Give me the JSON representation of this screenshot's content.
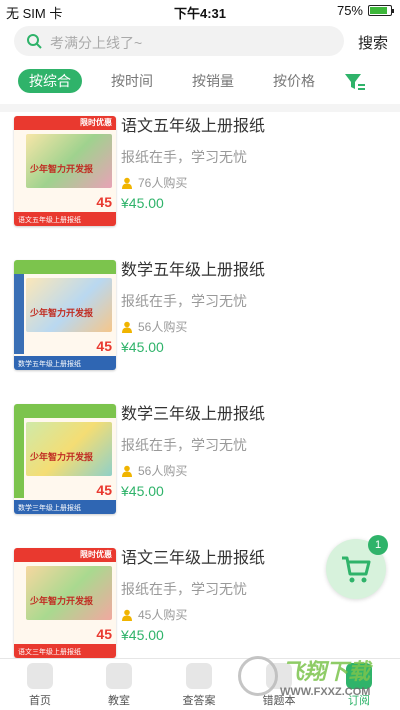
{
  "status_bar": {
    "carrier": "无 SIM 卡",
    "time": "下午4:31",
    "battery": "75%",
    "battery_level": 0.75
  },
  "search": {
    "placeholder": "考满分上线了~",
    "button": "搜索"
  },
  "tabs": [
    {
      "label": "按综合",
      "active": true
    },
    {
      "label": "按时间",
      "active": false
    },
    {
      "label": "按销量",
      "active": false
    },
    {
      "label": "按价格",
      "active": false
    }
  ],
  "items": [
    {
      "title": "语文五年级上册报纸",
      "subtitle": "报纸在手，学习无忧",
      "buyers": "76人购买",
      "price": "¥45.00",
      "cover": {
        "top_label": "少年智力开发报",
        "badge": "限时优惠",
        "bottom_label": "语文五年级上册报纸",
        "price": "45"
      }
    },
    {
      "title": "数学五年级上册报纸",
      "subtitle": "报纸在手，学习无忧",
      "buyers": "56人购买",
      "price": "¥45.00",
      "cover": {
        "top_label": "少年智力开发报",
        "badge": "",
        "bottom_label": "数学五年级上册报纸",
        "price": "45"
      }
    },
    {
      "title": "数学三年级上册报纸",
      "subtitle": "报纸在手，学习无忧",
      "buyers": "56人购买",
      "price": "¥45.00",
      "cover": {
        "top_label": "少年智力开发报",
        "badge": "",
        "bottom_label": "数学三年级上册报纸",
        "price": "45"
      }
    },
    {
      "title": "语文三年级上册报纸",
      "subtitle": "报纸在手，学习无忧",
      "buyers": "45人购买",
      "price": "¥45.00",
      "cover": {
        "top_label": "少年智力开发报",
        "badge": "限时优惠",
        "bottom_label": "语文三年级上册报纸",
        "price": "45"
      }
    }
  ],
  "cart": {
    "count": "1"
  },
  "tabbar": [
    {
      "label": "首页",
      "icon": "home-icon",
      "active": false
    },
    {
      "label": "教室",
      "icon": "classroom-icon",
      "active": false
    },
    {
      "label": "查答案",
      "icon": "answer-icon",
      "active": false
    },
    {
      "label": "错题本",
      "icon": "notebook-icon",
      "active": false
    },
    {
      "label": "订阅",
      "icon": "subscribe-icon",
      "active": true
    }
  ],
  "watermark": {
    "line1": "飞翔下载",
    "line2": "WWW.FXXZ.COM"
  },
  "colors": {
    "accent": "#2fb36a",
    "price": "#2fb36a"
  }
}
